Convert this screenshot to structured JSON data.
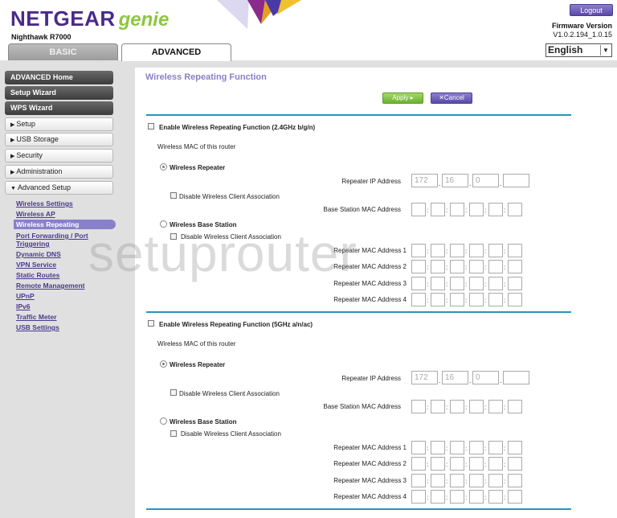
{
  "header": {
    "brand_name": "NETGEAR",
    "brand_suffix": "genie",
    "model": "Nighthawk R7000",
    "logout_label": "Logout",
    "firmware_label": "Firmware Version",
    "firmware_value": "V1.0.2.194_1.0.15",
    "language": "English"
  },
  "tabs": {
    "basic": "BASIC",
    "advanced": "ADVANCED"
  },
  "sidebar": {
    "top": [
      "ADVANCED Home",
      "Setup Wizard",
      "WPS Wizard"
    ],
    "sections": [
      "Setup",
      "USB Storage",
      "Security",
      "Administration",
      "Advanced Setup"
    ],
    "sub": [
      "Wireless Settings",
      "Wireless AP",
      "Wireless Repeating",
      "Port Forwarding / Port",
      "Triggering",
      "Dynamic DNS",
      "VPN Service",
      "Static Routes",
      "Remote Management",
      "UPnP",
      "IPv6",
      "Traffic Meter",
      "USB Settings"
    ]
  },
  "main": {
    "title": "Wireless Repeating Function",
    "apply": "Apply ▸",
    "cancel": "✕Cancel",
    "band24": {
      "enable": "Enable Wireless Repeating Function (2.4GHz b/g/n)",
      "mac_label": "Wireless MAC of this router",
      "repeater": "Wireless Repeater",
      "repeater_ip_label": "Repeater IP Address",
      "ip": [
        "172",
        "16",
        "0",
        ""
      ],
      "disable_assoc": "Disable Wireless Client Association",
      "base_mac_label": "Base Station MAC Address",
      "base_station": "Wireless Base Station",
      "disable_assoc2": "Disable Wireless Client Association",
      "rep_mac": [
        "Repeater MAC Address 1",
        "Repeater MAC Address 2",
        "Repeater MAC Address 3",
        "Repeater MAC Address 4"
      ]
    },
    "band5": {
      "enable": "Enable Wireless Repeating Function (5GHz a/n/ac)",
      "mac_label": "Wireless MAC of this router",
      "repeater": "Wireless Repeater",
      "repeater_ip_label": "Repeater IP Address",
      "ip": [
        "172",
        "16",
        "0",
        ""
      ],
      "disable_assoc": "Disable Wireless Client Association",
      "base_mac_label": "Base Station MAC Address",
      "base_station": "Wireless Base Station",
      "disable_assoc2": "Disable Wireless Client Association",
      "rep_mac": [
        "Repeater MAC Address 1",
        "Repeater MAC Address 2",
        "Repeater MAC Address 3",
        "Repeater MAC Address 4"
      ]
    }
  },
  "watermark": "setuprouter"
}
